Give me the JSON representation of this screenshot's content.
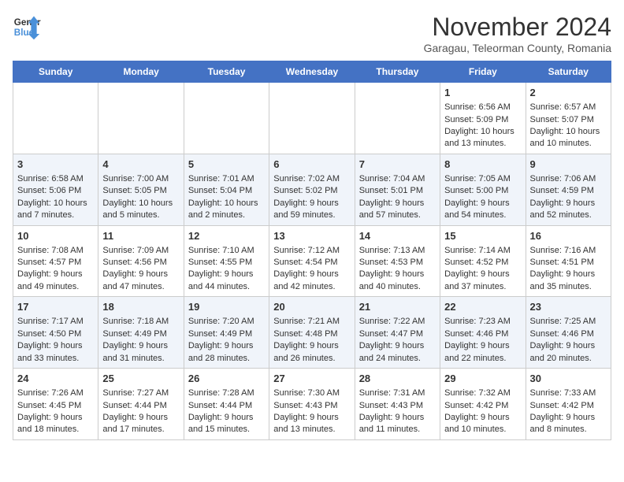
{
  "header": {
    "logo_line1": "General",
    "logo_line2": "Blue",
    "month_title": "November 2024",
    "subtitle": "Garagau, Teleorman County, Romania"
  },
  "days_of_week": [
    "Sunday",
    "Monday",
    "Tuesday",
    "Wednesday",
    "Thursday",
    "Friday",
    "Saturday"
  ],
  "weeks": [
    [
      {
        "day": "",
        "info": ""
      },
      {
        "day": "",
        "info": ""
      },
      {
        "day": "",
        "info": ""
      },
      {
        "day": "",
        "info": ""
      },
      {
        "day": "",
        "info": ""
      },
      {
        "day": "1",
        "info": "Sunrise: 6:56 AM\nSunset: 5:09 PM\nDaylight: 10 hours and 13 minutes."
      },
      {
        "day": "2",
        "info": "Sunrise: 6:57 AM\nSunset: 5:07 PM\nDaylight: 10 hours and 10 minutes."
      }
    ],
    [
      {
        "day": "3",
        "info": "Sunrise: 6:58 AM\nSunset: 5:06 PM\nDaylight: 10 hours and 7 minutes."
      },
      {
        "day": "4",
        "info": "Sunrise: 7:00 AM\nSunset: 5:05 PM\nDaylight: 10 hours and 5 minutes."
      },
      {
        "day": "5",
        "info": "Sunrise: 7:01 AM\nSunset: 5:04 PM\nDaylight: 10 hours and 2 minutes."
      },
      {
        "day": "6",
        "info": "Sunrise: 7:02 AM\nSunset: 5:02 PM\nDaylight: 9 hours and 59 minutes."
      },
      {
        "day": "7",
        "info": "Sunrise: 7:04 AM\nSunset: 5:01 PM\nDaylight: 9 hours and 57 minutes."
      },
      {
        "day": "8",
        "info": "Sunrise: 7:05 AM\nSunset: 5:00 PM\nDaylight: 9 hours and 54 minutes."
      },
      {
        "day": "9",
        "info": "Sunrise: 7:06 AM\nSunset: 4:59 PM\nDaylight: 9 hours and 52 minutes."
      }
    ],
    [
      {
        "day": "10",
        "info": "Sunrise: 7:08 AM\nSunset: 4:57 PM\nDaylight: 9 hours and 49 minutes."
      },
      {
        "day": "11",
        "info": "Sunrise: 7:09 AM\nSunset: 4:56 PM\nDaylight: 9 hours and 47 minutes."
      },
      {
        "day": "12",
        "info": "Sunrise: 7:10 AM\nSunset: 4:55 PM\nDaylight: 9 hours and 44 minutes."
      },
      {
        "day": "13",
        "info": "Sunrise: 7:12 AM\nSunset: 4:54 PM\nDaylight: 9 hours and 42 minutes."
      },
      {
        "day": "14",
        "info": "Sunrise: 7:13 AM\nSunset: 4:53 PM\nDaylight: 9 hours and 40 minutes."
      },
      {
        "day": "15",
        "info": "Sunrise: 7:14 AM\nSunset: 4:52 PM\nDaylight: 9 hours and 37 minutes."
      },
      {
        "day": "16",
        "info": "Sunrise: 7:16 AM\nSunset: 4:51 PM\nDaylight: 9 hours and 35 minutes."
      }
    ],
    [
      {
        "day": "17",
        "info": "Sunrise: 7:17 AM\nSunset: 4:50 PM\nDaylight: 9 hours and 33 minutes."
      },
      {
        "day": "18",
        "info": "Sunrise: 7:18 AM\nSunset: 4:49 PM\nDaylight: 9 hours and 31 minutes."
      },
      {
        "day": "19",
        "info": "Sunrise: 7:20 AM\nSunset: 4:49 PM\nDaylight: 9 hours and 28 minutes."
      },
      {
        "day": "20",
        "info": "Sunrise: 7:21 AM\nSunset: 4:48 PM\nDaylight: 9 hours and 26 minutes."
      },
      {
        "day": "21",
        "info": "Sunrise: 7:22 AM\nSunset: 4:47 PM\nDaylight: 9 hours and 24 minutes."
      },
      {
        "day": "22",
        "info": "Sunrise: 7:23 AM\nSunset: 4:46 PM\nDaylight: 9 hours and 22 minutes."
      },
      {
        "day": "23",
        "info": "Sunrise: 7:25 AM\nSunset: 4:46 PM\nDaylight: 9 hours and 20 minutes."
      }
    ],
    [
      {
        "day": "24",
        "info": "Sunrise: 7:26 AM\nSunset: 4:45 PM\nDaylight: 9 hours and 18 minutes."
      },
      {
        "day": "25",
        "info": "Sunrise: 7:27 AM\nSunset: 4:44 PM\nDaylight: 9 hours and 17 minutes."
      },
      {
        "day": "26",
        "info": "Sunrise: 7:28 AM\nSunset: 4:44 PM\nDaylight: 9 hours and 15 minutes."
      },
      {
        "day": "27",
        "info": "Sunrise: 7:30 AM\nSunset: 4:43 PM\nDaylight: 9 hours and 13 minutes."
      },
      {
        "day": "28",
        "info": "Sunrise: 7:31 AM\nSunset: 4:43 PM\nDaylight: 9 hours and 11 minutes."
      },
      {
        "day": "29",
        "info": "Sunrise: 7:32 AM\nSunset: 4:42 PM\nDaylight: 9 hours and 10 minutes."
      },
      {
        "day": "30",
        "info": "Sunrise: 7:33 AM\nSunset: 4:42 PM\nDaylight: 9 hours and 8 minutes."
      }
    ]
  ]
}
